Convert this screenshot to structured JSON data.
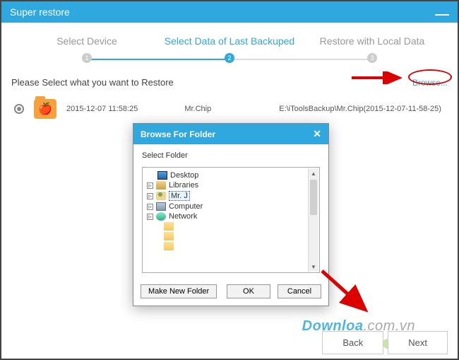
{
  "window": {
    "title": "Super restore"
  },
  "stepper": {
    "step1": "Select Device",
    "step2": "Select Data of Last Backuped",
    "step3": "Restore with Local Data",
    "n1": "1",
    "n2": "2",
    "n3": "3"
  },
  "instruction": "Please Select what you want to Restore",
  "browse": "Browse...",
  "backup": {
    "date": "2015-12-07 11:58:25",
    "user": "Mr.Chip",
    "path": "E:\\iToolsBackup\\Mr.Chip(2015-12-07-11-58-25)"
  },
  "modal": {
    "title": "Browse For Folder",
    "subtitle": "Select Folder",
    "close": "✕",
    "tree": {
      "desktop": "Desktop",
      "libraries": "Libraries",
      "mrj": "Mr. J",
      "computer": "Computer",
      "network": "Network"
    },
    "buttons": {
      "make": "Make New Folder",
      "ok": "OK",
      "cancel": "Cancel"
    }
  },
  "footer": {
    "back": "Back",
    "next": "Next"
  },
  "watermark": {
    "main": "Downloa",
    "suffix": ".com.vn"
  }
}
